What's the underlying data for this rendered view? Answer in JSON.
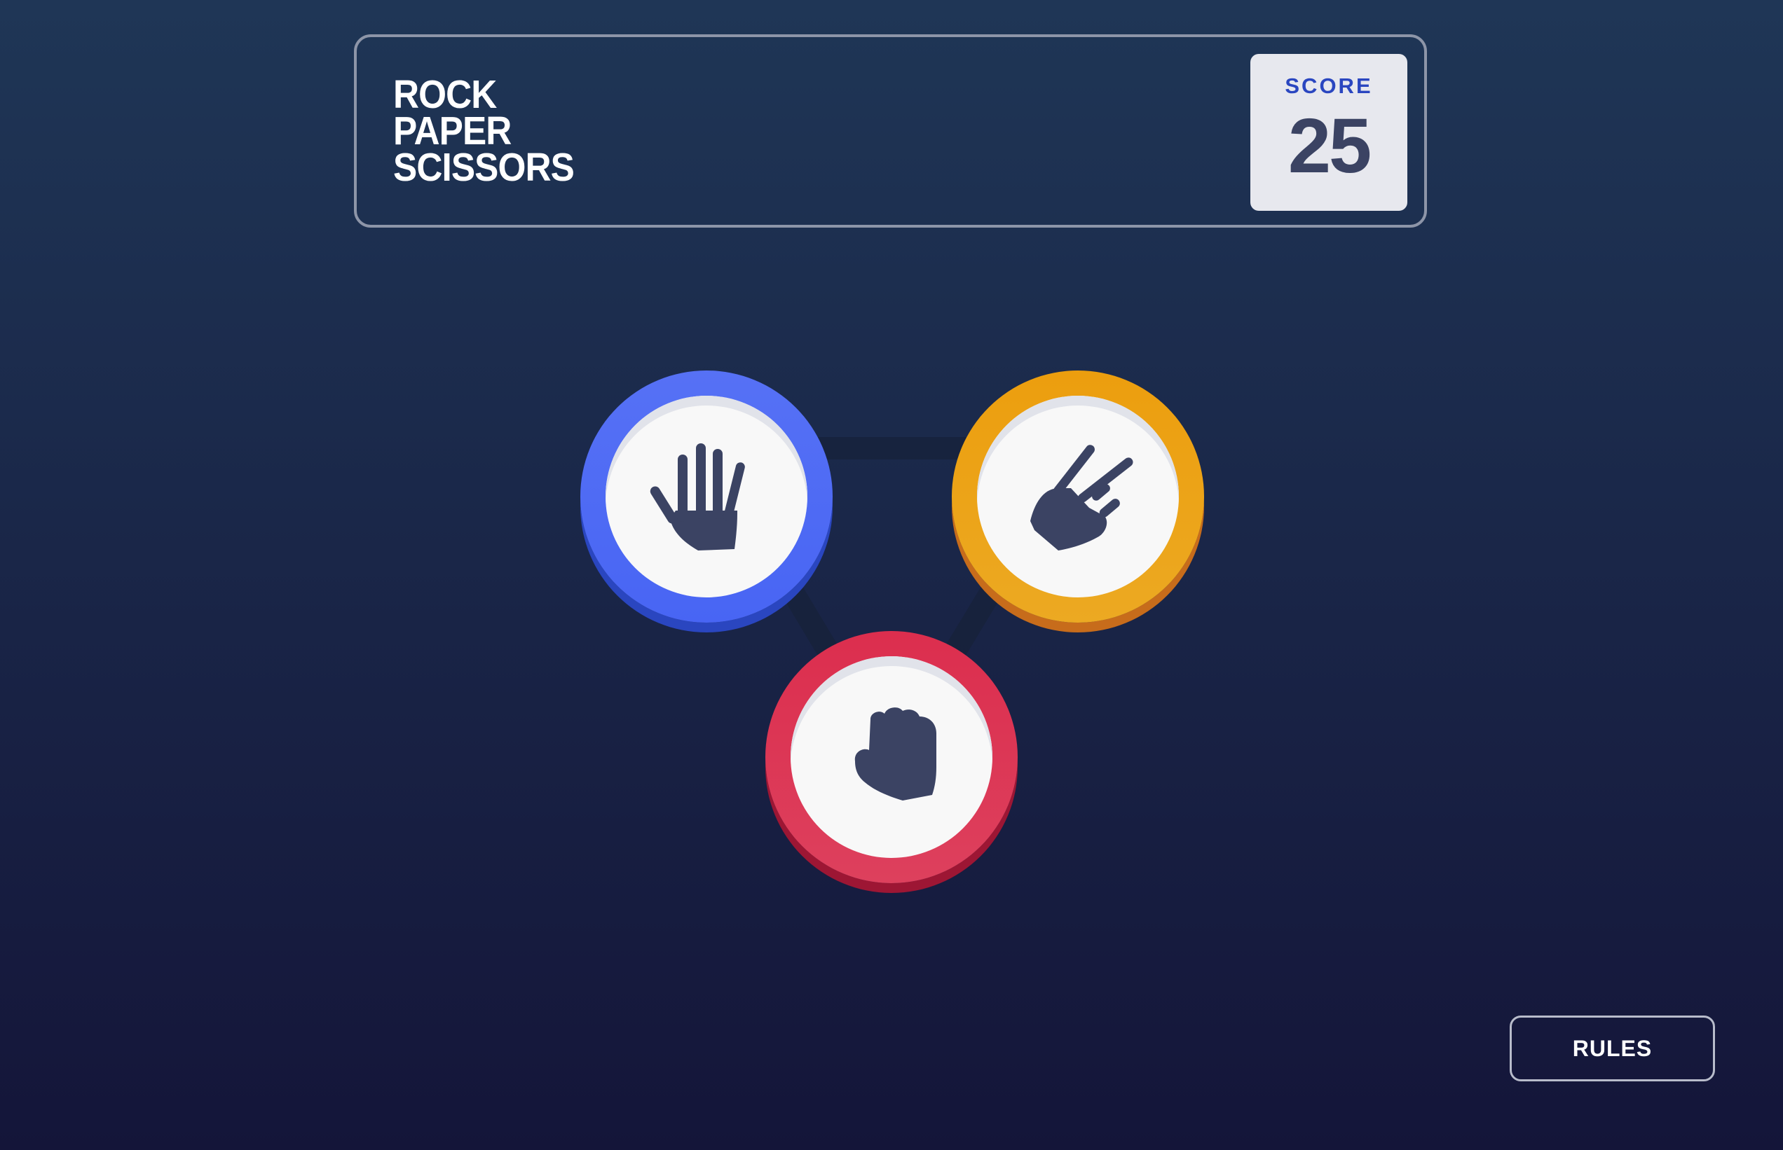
{
  "header": {
    "title_lines": [
      "ROCK",
      "PAPER",
      "SCISSORS"
    ],
    "score_label": "SCORE",
    "score_value": "25"
  },
  "choices": [
    {
      "id": "paper",
      "icon": "paper-hand-icon",
      "ring_color": "#4865f4"
    },
    {
      "id": "scissors",
      "icon": "scissors-hand-icon",
      "ring_color": "#ec9e0e"
    },
    {
      "id": "rock",
      "icon": "rock-hand-icon",
      "ring_color": "#dc2e4e"
    }
  ],
  "colors": {
    "background_top": "#1f3656",
    "background_bottom": "#141539",
    "score_text": "#2a46c0",
    "score_number": "#3b4363",
    "icon": "#3b4363"
  },
  "footer": {
    "rules_label": "RULES"
  }
}
